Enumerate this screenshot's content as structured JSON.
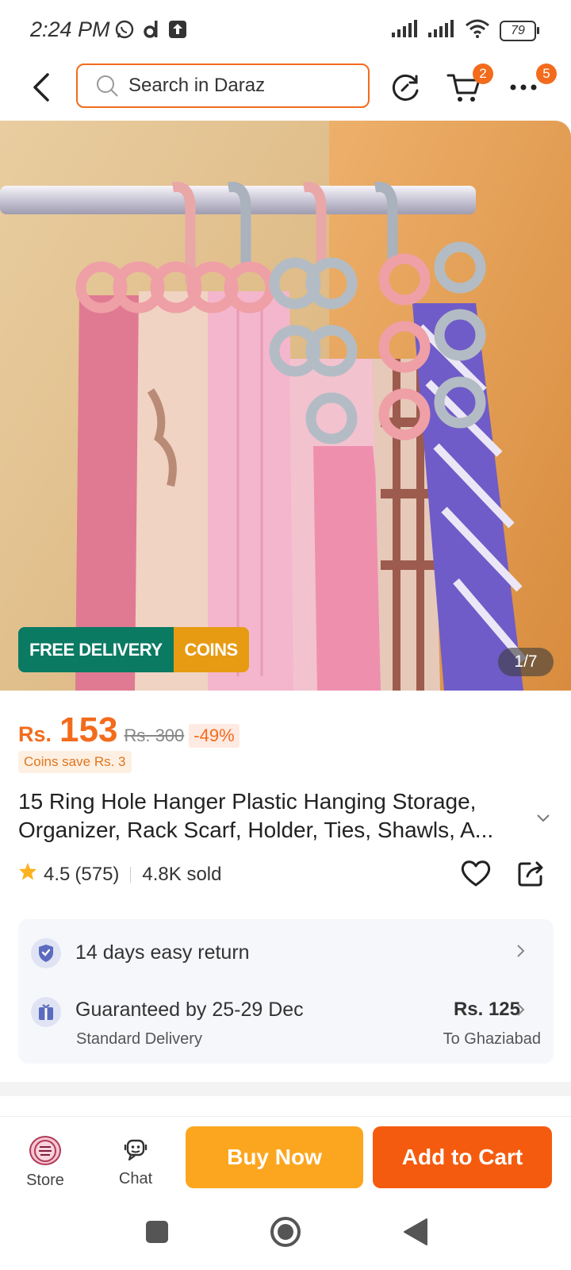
{
  "status_bar": {
    "time": "2:24 PM",
    "battery": "79"
  },
  "nav": {
    "search_placeholder": "Search in Daraz",
    "cart_count": "2",
    "more_count": "5"
  },
  "gallery": {
    "promo_free_delivery": "FREE DELIVERY",
    "promo_coins": "COINS",
    "counter": "1/7"
  },
  "pricing": {
    "currency": "Rs.",
    "price": "153",
    "original_price": "Rs. 300",
    "discount": "-49%",
    "coins_save": "Coins save Rs. 3"
  },
  "product": {
    "title_line1": "15 Ring Hole Hanger Plastic Hanging Storage,",
    "title_line2": "Organizer, Rack Scarf, Holder, Ties, Shawls, A...",
    "rating": "4.5",
    "rating_count": "(575)",
    "sold": "4.8K sold"
  },
  "delivery": {
    "return_text": "14 days easy return",
    "guarantee_text": "Guaranteed by 25-29 Dec",
    "delivery_type": "Standard Delivery",
    "fee": "Rs. 125",
    "destination": "To Ghaziabad"
  },
  "bottom_bar": {
    "store_label": "Store",
    "chat_label": "Chat",
    "buy_now": "Buy Now",
    "add_to_cart": "Add to Cart"
  },
  "colors": {
    "brand_orange": "#f36b1c",
    "buy_now": "#fca61f",
    "add_to_cart": "#f55b0e",
    "free_delivery": "#0a7a63",
    "coins": "#e79b12"
  }
}
